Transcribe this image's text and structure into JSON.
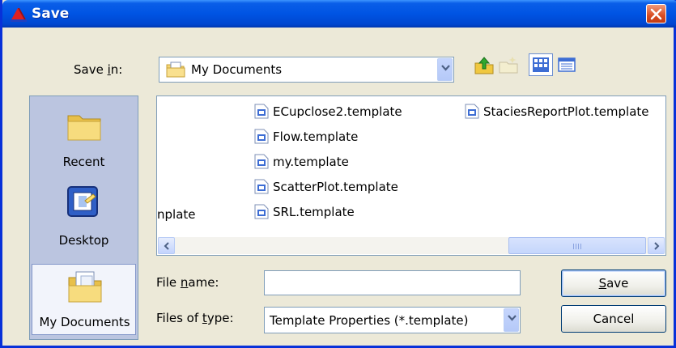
{
  "window": {
    "title": "Save"
  },
  "toolbar": {
    "save_in_label_pre": "Save ",
    "save_in_label_key": "i",
    "save_in_label_post": "n:",
    "save_in_value": "My Documents"
  },
  "places": [
    {
      "label": "Recent",
      "icon": "recent-folder-icon"
    },
    {
      "label": "Desktop",
      "icon": "desktop-icon"
    },
    {
      "label": "My Documents",
      "icon": "my-documents-icon",
      "selected": true
    }
  ],
  "files": {
    "column1_partial": "nplate",
    "column2": [
      "ECupclose2.template",
      "Flow.template",
      "my.template",
      "ScatterPlot.template",
      "SRL.template"
    ],
    "column3": [
      "StaciesReportPlot.template"
    ]
  },
  "form": {
    "file_name_pre": "File ",
    "file_name_key": "n",
    "file_name_post": "ame:",
    "file_name_value": "",
    "file_type_pre": "Files of ",
    "file_type_key": "t",
    "file_type_post": "ype:",
    "file_type_value": "Template Properties (*.template)"
  },
  "buttons": {
    "save_key": "S",
    "save_rest": "ave",
    "cancel": "Cancel"
  },
  "colors": {
    "titlebar": "#0054e3",
    "window": "#ece9d8",
    "close": "#d84d22"
  }
}
